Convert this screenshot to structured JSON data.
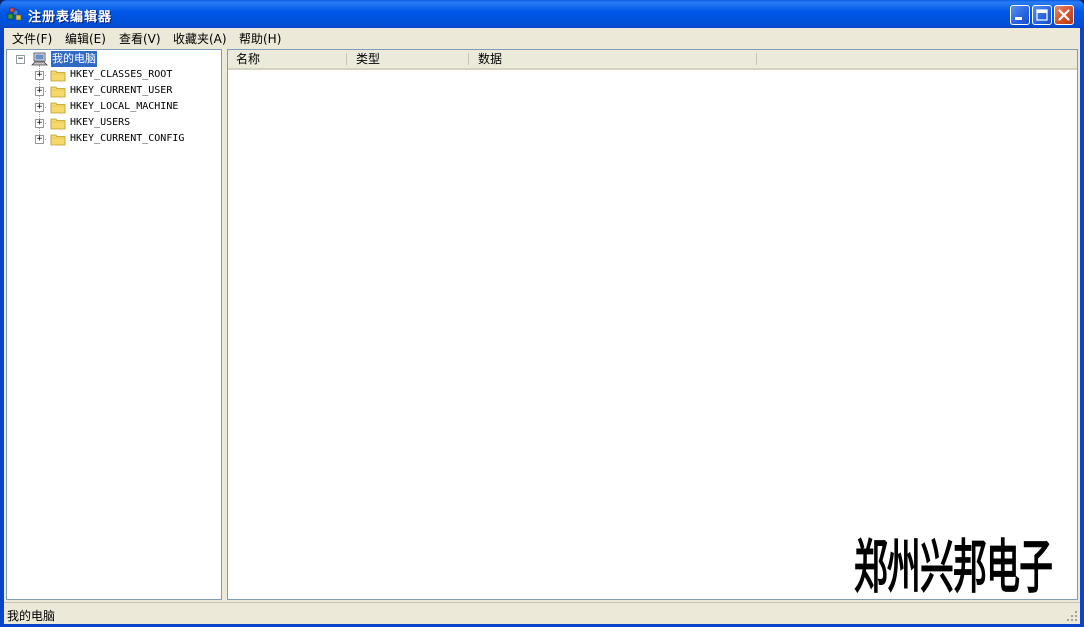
{
  "window": {
    "title": "注册表编辑器"
  },
  "menubar": {
    "items": [
      {
        "label": "文件(F)"
      },
      {
        "label": "编辑(E)"
      },
      {
        "label": "查看(V)"
      },
      {
        "label": "收藏夹(A)"
      },
      {
        "label": "帮助(H)"
      }
    ]
  },
  "tree": {
    "root": {
      "label": "我的电脑",
      "expanded": true,
      "selected": true
    },
    "children": [
      {
        "label": "HKEY_CLASSES_ROOT"
      },
      {
        "label": "HKEY_CURRENT_USER"
      },
      {
        "label": "HKEY_LOCAL_MACHINE"
      },
      {
        "label": "HKEY_USERS"
      },
      {
        "label": "HKEY_CURRENT_CONFIG"
      }
    ]
  },
  "list": {
    "columns": [
      "名称",
      "类型",
      "数据"
    ]
  },
  "statusbar": {
    "text": "我的电脑"
  },
  "watermark": {
    "text": "郑州兴邦电子"
  },
  "colors": {
    "titlebar": "#0054e3",
    "selection": "#316ac5",
    "close_button": "#d4502a"
  },
  "icons": [
    "registry-editor-icon",
    "computer-icon",
    "folder-icon",
    "minimize-icon",
    "maximize-icon",
    "close-icon",
    "expand-plus-icon",
    "collapse-minus-icon",
    "resize-grip-icon"
  ]
}
